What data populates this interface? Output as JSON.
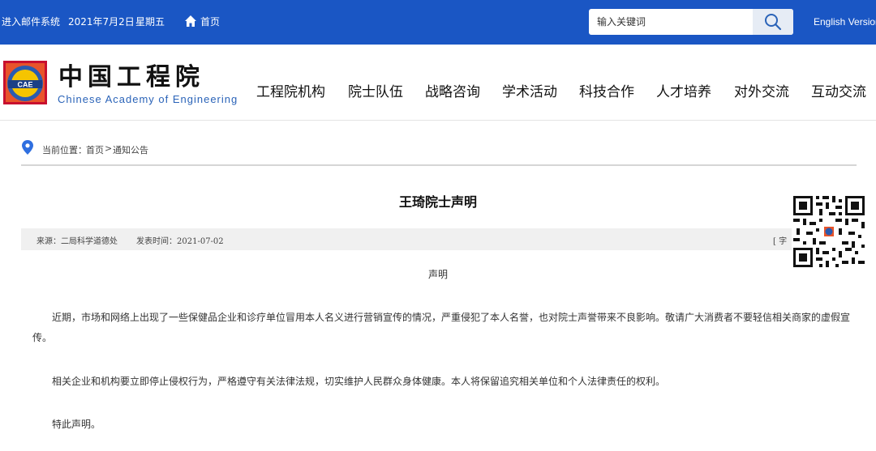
{
  "topbar": {
    "mail_link": "进入邮件系统",
    "date": "2021年7月2日",
    "weekday": "星期五",
    "home_link": "首页",
    "search_placeholder": "输入关键词",
    "english_link": "English Version"
  },
  "header": {
    "logo_text": "CAE",
    "brand_cn": "中国工程院",
    "brand_en": "Chinese Academy of Engineering",
    "nav": [
      {
        "label": "工程院机构"
      },
      {
        "label": "院士队伍"
      },
      {
        "label": "战略咨询"
      },
      {
        "label": "学术活动"
      },
      {
        "label": "科技合作"
      },
      {
        "label": "人才培养"
      },
      {
        "label": "对外交流"
      },
      {
        "label": "互动交流"
      }
    ]
  },
  "breadcrumb": {
    "prefix": "当前位置：",
    "home": "首页",
    "separator": ">",
    "current": "通知公告"
  },
  "article": {
    "title": "王琦院士声明",
    "source": "来源：二局科学道德处",
    "published": "发表时间：2021-07-02",
    "font_size_control": "[ 字",
    "heading": "声明",
    "paragraphs": [
      "近期，市场和网络上出现了一些保健品企业和诊疗单位冒用本人名义进行营销宣传的情况，严重侵犯了本人名誉，也对院士声誉带来不良影响。敬请广大消费者不要轻信相关商家的虚假宣传。",
      "相关企业和机构要立即停止侵权行为，严格遵守有关法律法规，切实维护人民群众身体健康。本人将保留追究相关单位和个人法律责任的权利。",
      "特此声明。"
    ]
  },
  "colors": {
    "topbar_bg": "#1a56c4",
    "brand_blue": "#2a63b8",
    "pin_blue": "#2f6fe0"
  }
}
